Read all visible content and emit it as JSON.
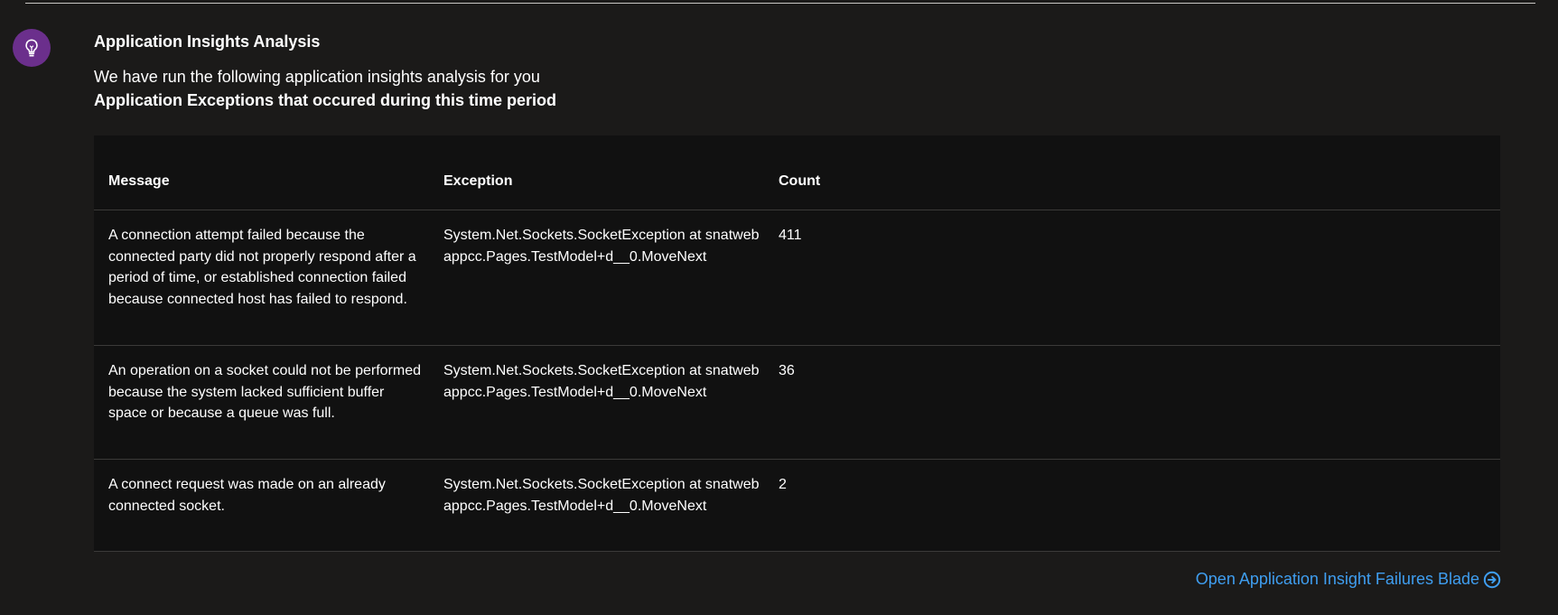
{
  "header": {
    "title": "Application Insights Analysis",
    "description": "We have run the following application insights analysis for you",
    "subtitle": "Application Exceptions that occured during this time period"
  },
  "icon": {
    "name": "lightbulb-icon",
    "color": "#6b2f8c"
  },
  "table": {
    "columns": [
      "Message",
      "Exception",
      "Count"
    ],
    "rows": [
      {
        "message": "A connection attempt failed because the connected party did not properly respond after a period of time, or established connection failed because connected host has failed to respond.",
        "exception": "System.Net.Sockets.SocketException at snatwebappcc.Pages.TestModel+d__0.MoveNext",
        "count": "411"
      },
      {
        "message": "An operation on a socket could not be performed because the system lacked sufficient buffer space or because a queue was full.",
        "exception": "System.Net.Sockets.SocketException at snatwebappcc.Pages.TestModel+d__0.MoveNext",
        "count": "36"
      },
      {
        "message": "A connect request was made on an already connected socket.",
        "exception": "System.Net.Sockets.SocketException at snatwebappcc.Pages.TestModel+d__0.MoveNext",
        "count": "2"
      }
    ]
  },
  "link": {
    "label": "Open Application Insight Failures Blade",
    "icon": "arrow-circle-right-icon",
    "color": "#3f9ef0"
  }
}
